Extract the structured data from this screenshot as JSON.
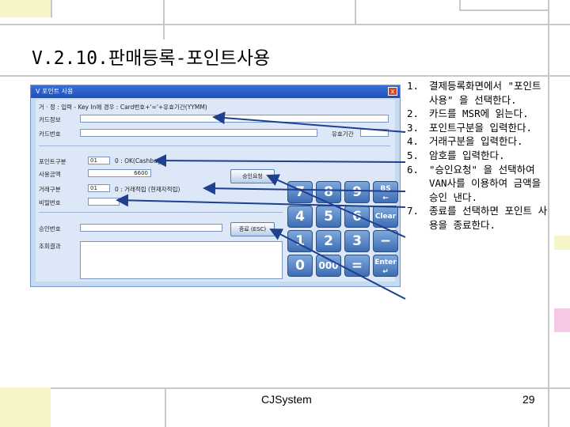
{
  "slide": {
    "title": "V.2.10.판매등록-포인트사용",
    "footer_company": "CJSystem",
    "page_number": "29"
  },
  "window": {
    "title": "V 포인트 사용",
    "close_glyph": "x",
    "instruction": "거 · 정 : 입력 - Key In에 경우 : Card번호+'='+유효기간(YYMM)",
    "card_info_label": "카드정보",
    "card_number_label": "카드번호",
    "expiry_label": "유효기간",
    "point_type_label": "포인트구분",
    "point_type_code": "01",
    "point_type_desc": "0 : OK(Cashbag)",
    "use_amount_label": "사용금액",
    "use_amount_value": "6600",
    "trade_type_label": "거래구분",
    "trade_type_code": "01",
    "trade_type_desc": "0 : 거래적립 (현재자적립)",
    "password_label": "비밀번호",
    "approval_no_label": "승인번호",
    "memo_label": "조회결과",
    "approve_button": "승인요청",
    "exit_button": "종료 (ESC)"
  },
  "keypad": {
    "row1": [
      "7",
      "8",
      "9"
    ],
    "row2": [
      "4",
      "5",
      "6"
    ],
    "row3": [
      "1",
      "2",
      "3"
    ],
    "row4": [
      "0",
      "000",
      "="
    ],
    "bs": "BS",
    "bs_arrow": "←",
    "clear": "Clear",
    "minus": "−",
    "enter": "Enter",
    "enter_arrow": "↵"
  },
  "steps": [
    {
      "num": "1.",
      "text": "결제등록화면에서 \"포인트 사용\" 을 선택한다."
    },
    {
      "num": "2.",
      "text": "카드를 MSR에 읽는다."
    },
    {
      "num": "3.",
      "text": "포인트구분을 입력한다."
    },
    {
      "num": "4.",
      "text": "거래구분을 입력한다."
    },
    {
      "num": "5.",
      "text": "암호를 입력한다."
    },
    {
      "num": "6.",
      "text": "\"승인요청\" 을 선택하여 VAN사를 이용하여 금액을 승인 낸다."
    },
    {
      "num": "7.",
      "text": "종료를 선택하면 포인트 사용을 종료한다."
    }
  ],
  "colors": {
    "window_bg": "#c5d9f1",
    "titlebar": "#1d4fb8",
    "key_blue": "#3d6db3",
    "arrow": "#1f3f8f"
  }
}
